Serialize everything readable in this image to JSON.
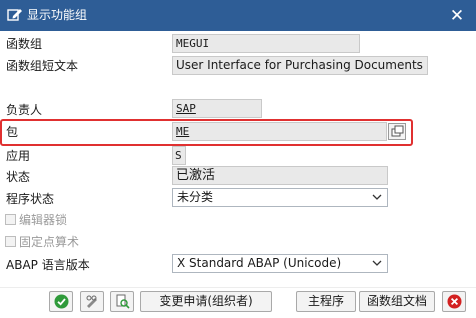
{
  "window": {
    "title": "显示功能组",
    "title_icon": "display-edit-icon",
    "close_glyph": "✕"
  },
  "form": {
    "function_group_label": "函数组",
    "function_group_value": "MEGUI",
    "short_text_label": "函数组短文本",
    "short_text_value": "User Interface for Purchasing Documents",
    "responsible_label": "负责人",
    "responsible_value": "SAP",
    "package_label": "包",
    "package_value": "ME",
    "application_label": "应用",
    "application_value": "S",
    "status_label": "状态",
    "status_value": "已激活",
    "program_status_label": "程序状态",
    "program_status_value": "未分类",
    "editor_lock_label": "编辑器锁",
    "fixed_point_label": "固定点算术",
    "abap_version_label": "ABAP 语言版本",
    "abap_version_value": "X Standard ABAP (Unicode)"
  },
  "toolbar": {
    "change_request_label": "变更申请(组织者)",
    "main_program_label": "主程序",
    "function_group_docs_label": "函数组文档"
  },
  "colors": {
    "titlebar": "#2e5d96",
    "highlight": "#e03030",
    "confirm": "#2f9a3a",
    "cancel": "#d32020"
  }
}
